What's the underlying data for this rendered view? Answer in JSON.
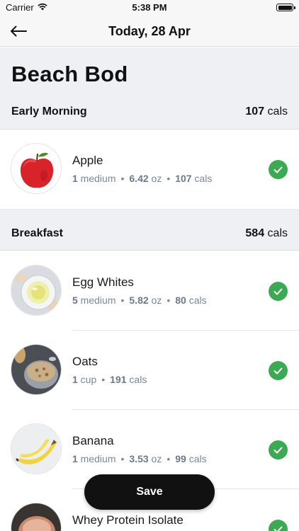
{
  "status_bar": {
    "carrier": "Carrier",
    "time": "5:38 PM"
  },
  "nav": {
    "title": "Today, 28 Apr"
  },
  "plan": {
    "title": "Beach Bod"
  },
  "sections": [
    {
      "name": "Early Morning",
      "cals_value": "107",
      "cals_unit": " cals",
      "items": [
        {
          "name": "Apple",
          "qty": "1",
          "qty_unit": " medium",
          "weight": "6.42",
          "weight_unit": " oz",
          "cals": "107",
          "cals_unit": " cals",
          "image_icon": "apple-image",
          "checked": true
        }
      ]
    },
    {
      "name": "Breakfast",
      "cals_value": "584",
      "cals_unit": " cals",
      "items": [
        {
          "name": "Egg Whites",
          "qty": "5",
          "qty_unit": " medium",
          "weight": "5.82",
          "weight_unit": " oz",
          "cals": "80",
          "cals_unit": " cals",
          "image_icon": "egg-whites-image",
          "checked": true
        },
        {
          "name": "Oats",
          "qty": "1",
          "qty_unit": " cup",
          "cals": "191",
          "cals_unit": " cals",
          "image_icon": "oats-image",
          "checked": true
        },
        {
          "name": "Banana",
          "qty": "1",
          "qty_unit": " medium",
          "weight": "3.53",
          "weight_unit": " oz",
          "cals": "99",
          "cals_unit": " cals",
          "image_icon": "banana-image",
          "checked": true
        },
        {
          "name": "Whey Protein Isolate",
          "image_icon": "whey-protein-image",
          "checked": true
        }
      ]
    }
  ],
  "dot": "•",
  "save_label": "Save",
  "colors": {
    "check_green": "#3caa52",
    "meta_gray": "#7b8698",
    "band_gray": "#eef0f3"
  }
}
